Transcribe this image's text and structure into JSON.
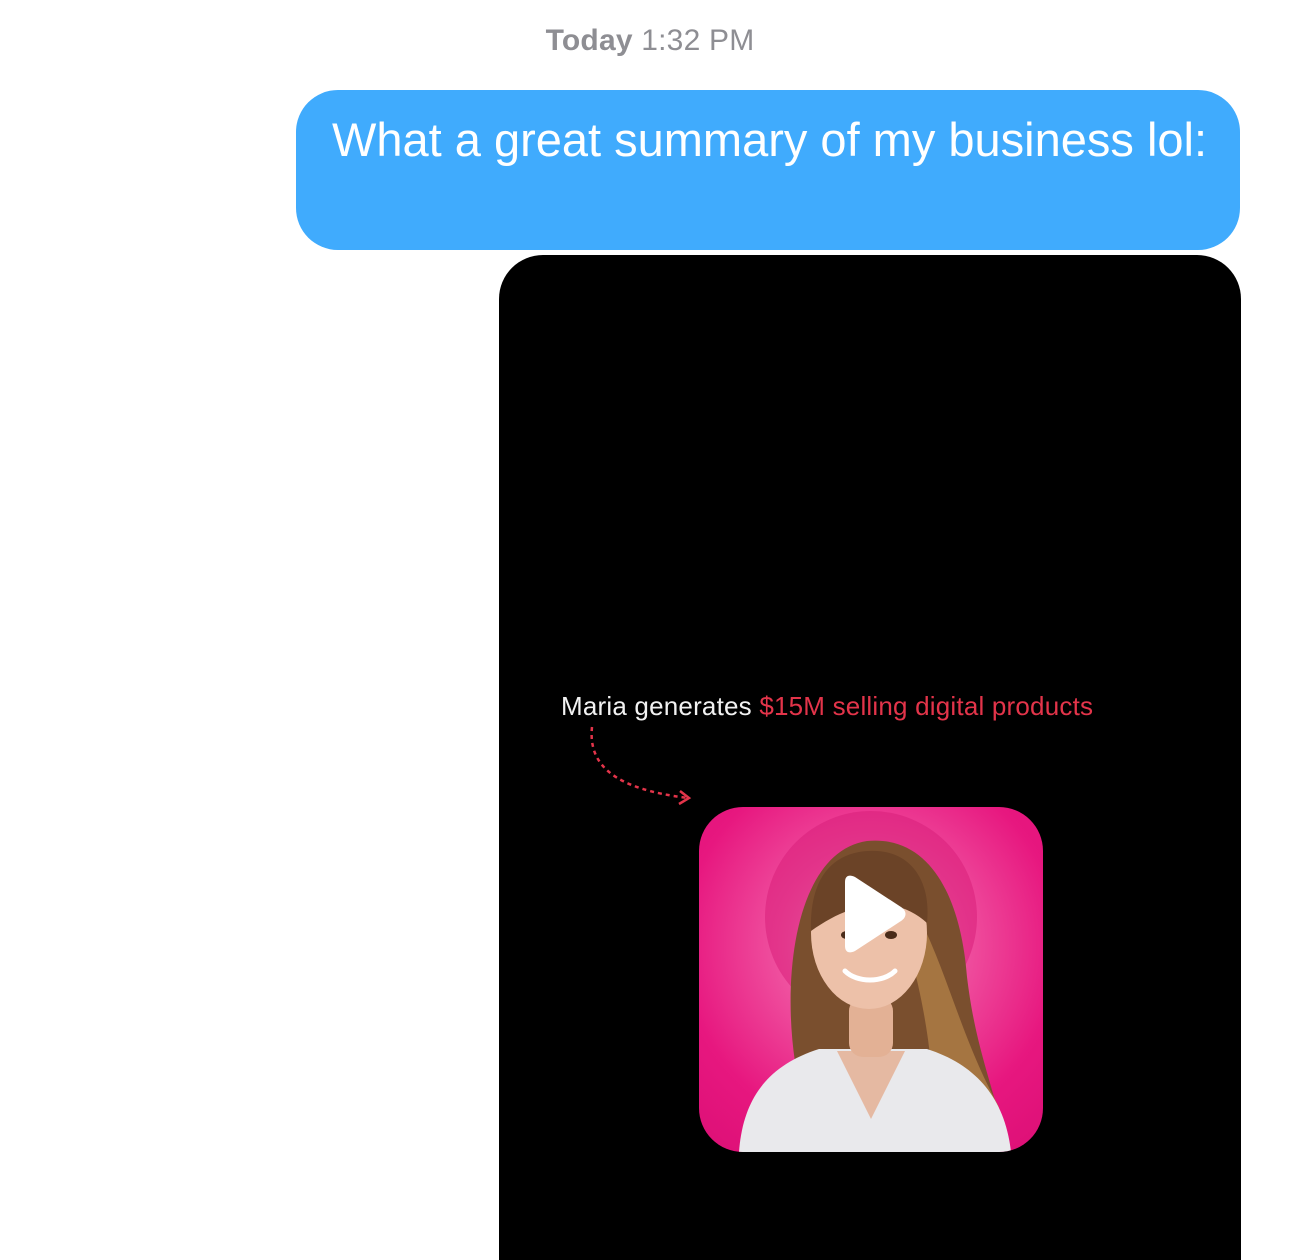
{
  "conversation": {
    "timestamp_day": "Today",
    "timestamp_time": "1:32 PM",
    "message_text": "What a great summary of my business lol:",
    "bubble_color": "#40abfd"
  },
  "attachment": {
    "type": "video",
    "caption_lead": "Maria generates",
    "caption_highlight": "$15M selling digital products",
    "highlight_color": "#e3344a",
    "card_color": "#e7177f",
    "play_icon": "play-icon"
  }
}
